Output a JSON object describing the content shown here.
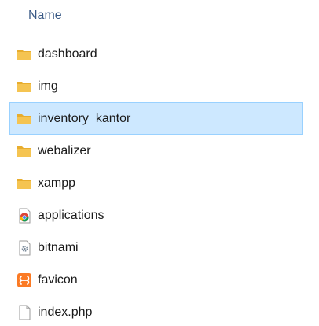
{
  "header": {
    "name_label": "Name"
  },
  "items": [
    {
      "label": "dashboard",
      "icon": "folder-icon",
      "selected": false
    },
    {
      "label": "img",
      "icon": "folder-icon",
      "selected": false
    },
    {
      "label": "inventory_kantor",
      "icon": "folder-icon",
      "selected": true
    },
    {
      "label": "webalizer",
      "icon": "folder-icon",
      "selected": false
    },
    {
      "label": "xampp",
      "icon": "folder-icon",
      "selected": false
    },
    {
      "label": "applications",
      "icon": "chrome-html-file-icon",
      "selected": false
    },
    {
      "label": "bitnami",
      "icon": "settings-file-icon",
      "selected": false
    },
    {
      "label": "favicon",
      "icon": "xampp-favicon-icon",
      "selected": false
    },
    {
      "label": "index.php",
      "icon": "blank-file-icon",
      "selected": false
    }
  ],
  "colors": {
    "folder": "#f5c451",
    "selection_bg": "#cde8ff",
    "selection_border": "#99d1ff",
    "header_text": "#3a5a86",
    "xampp_orange": "#fb7a24"
  }
}
